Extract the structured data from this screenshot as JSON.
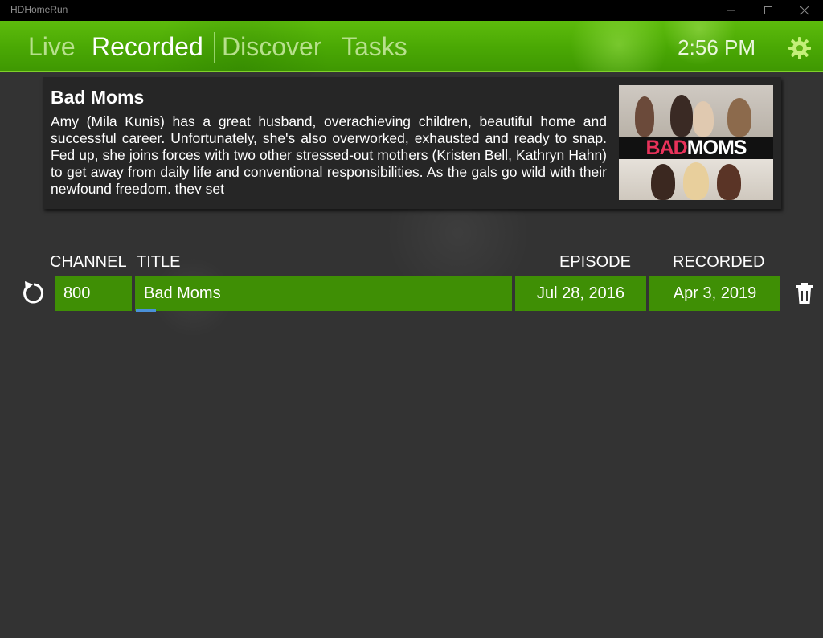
{
  "window": {
    "title": "HDHomeRun"
  },
  "nav": {
    "tabs": [
      {
        "label": "Live",
        "active": false
      },
      {
        "label": "Recorded",
        "active": true
      },
      {
        "label": "Discover",
        "active": false
      },
      {
        "label": "Tasks",
        "active": false
      }
    ],
    "clock": "2:56 PM",
    "settings_icon": "gear-icon"
  },
  "detail": {
    "title": "Bad Moms",
    "description": "Amy (Mila Kunis) has a great husband, overachieving children, beautiful home and successful career. Unfortunately, she's also overworked, exhausted and ready to snap. Fed up, she joins forces with two other stressed-out mothers (Kristen Bell, Kathryn Hahn) to get away from daily life and conventional responsibilities. As the gals go wild with their newfound freedom, they set",
    "poster": {
      "word1": "BAD",
      "word2": "MOMS"
    }
  },
  "table": {
    "columns": {
      "channel": "CHANNEL",
      "title": "TITLE",
      "episode": "EPISODE",
      "recorded": "RECORDED"
    },
    "rows": [
      {
        "channel": "800",
        "title": "Bad Moms",
        "episode": "Jul 28, 2016",
        "recorded": "Apr 3, 2019"
      }
    ]
  },
  "colors": {
    "accent_green": "#3f8f05",
    "header_green": "#4aa804",
    "background": "#333333",
    "focus_blue": "#4a90d9"
  }
}
